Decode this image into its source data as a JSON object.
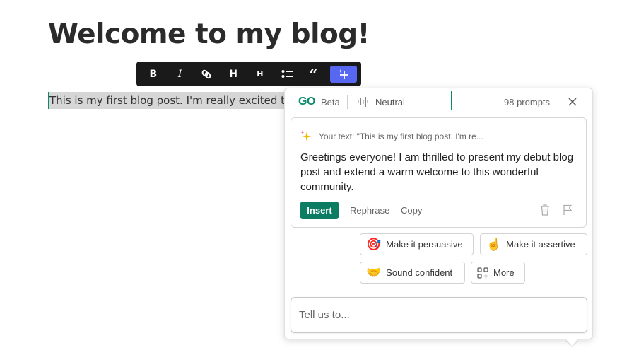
{
  "editor": {
    "title": "Welcome to my blog!",
    "body_text": "This is my first blog post. I'm really excited to we"
  },
  "toolbar": {
    "bold_label": "B",
    "italic_label": "I",
    "link_icon": "link-icon",
    "h1_label": "H",
    "h2_label": "H",
    "list_icon": "bullet-list-icon",
    "quote_label": "“",
    "ai_icon": "sparkle-plus-icon",
    "active_color": "#5867f2"
  },
  "panel": {
    "logo": "GO",
    "beta": "Beta",
    "tone_label": "Neutral",
    "prompts_count": "98 prompts",
    "accent_color": "#0c8a6c",
    "card": {
      "your_text": "Your text: \"This is my first blog post. I'm re...",
      "result": "Greetings everyone! I am thrilled to present my debut blog post and extend a warm welcome to this wonderful community.",
      "insert_label": "Insert",
      "rephrase_label": "Rephrase",
      "copy_label": "Copy"
    },
    "suggestions": [
      {
        "icon": "🎯",
        "label": "Make it persuasive"
      },
      {
        "icon": "☝",
        "label": "Make it assertive"
      },
      {
        "icon": "🤝",
        "label": "Sound confident"
      },
      {
        "icon": "grid-plus-icon",
        "label": "More"
      }
    ],
    "input_placeholder": "Tell us to..."
  }
}
